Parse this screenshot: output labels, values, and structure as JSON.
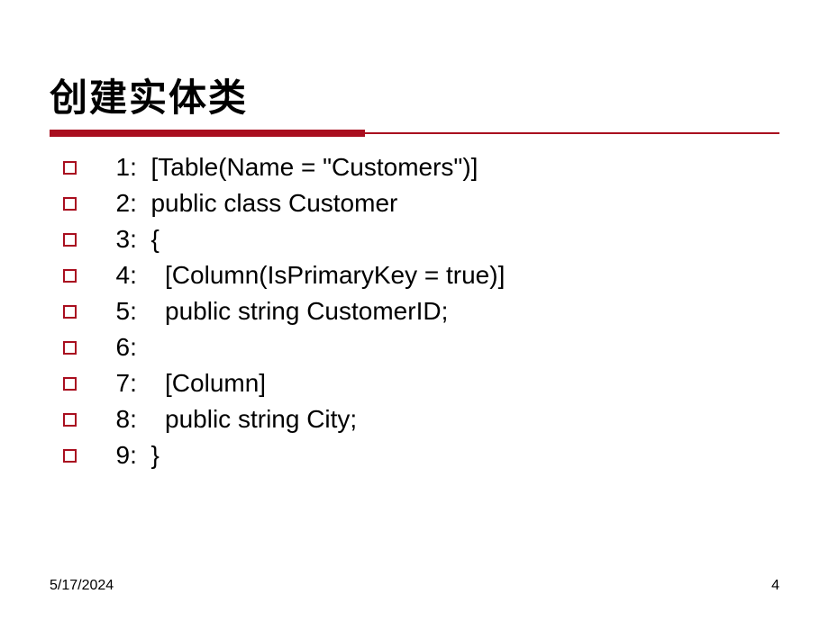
{
  "title": "创建实体类",
  "lines": [
    "  1:  [Table(Name = \"Customers\")]",
    "  2:  public class Customer",
    "  3:  {",
    "  4:    [Column(IsPrimaryKey = true)]",
    "  5:    public string CustomerID;",
    "  6:",
    "  7:    [Column]",
    "  8:    public string City;",
    "  9:  }"
  ],
  "footer": {
    "date": "5/17/2024",
    "page": "4"
  },
  "colors": {
    "accent": "#a90e1f"
  }
}
